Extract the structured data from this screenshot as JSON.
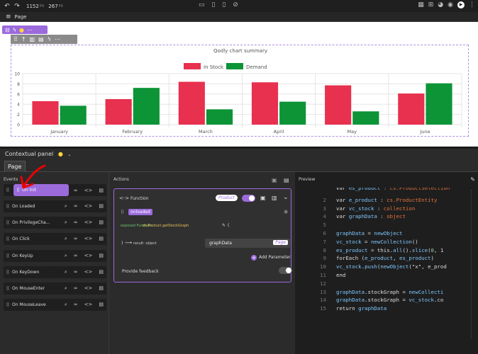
{
  "topbar": {
    "width_value": "1152",
    "width_unit": "PX",
    "height_value": "267",
    "height_unit": "PX"
  },
  "pagebar": {
    "label": "Page"
  },
  "chart_data": {
    "type": "bar",
    "title": "Qodly chart summary",
    "categories": [
      "January",
      "February",
      "March",
      "April",
      "May",
      "June"
    ],
    "series": [
      {
        "name": "In Stock",
        "color": "#e8304f",
        "values": [
          4.6,
          5.0,
          8.4,
          8.3,
          7.7,
          6.1
        ]
      },
      {
        "name": "Demand",
        "color": "#0c9436",
        "values": [
          3.7,
          7.2,
          3.0,
          4.5,
          2.6,
          8.1
        ]
      }
    ],
    "ylim": [
      0,
      10
    ],
    "yticks": [
      "0",
      "2",
      "4",
      "6",
      "8",
      "10"
    ],
    "grid": true,
    "legend": "top-center"
  },
  "contextual": {
    "title": "Contextual panel",
    "tab": "Page"
  },
  "events": {
    "title": "Events",
    "items": [
      {
        "label": "On Init"
      },
      {
        "label": "On Loaded"
      },
      {
        "label": "On PrivilegeCha..."
      },
      {
        "label": "On Click"
      },
      {
        "label": "On KeyUp"
      },
      {
        "label": "On KeyDown"
      },
      {
        "label": "On MouseEnter"
      },
      {
        "label": "On MouseLeave"
      }
    ]
  },
  "actions": {
    "title": "Actions",
    "function_label": "Function",
    "product_badge": "Product",
    "event_tag": "onloaded",
    "exposed_prefix": "exposed Function",
    "exposed_name": "ds.Product.getStockGraph",
    "exposed_suffix": "(",
    "result_prefix": ")",
    "result_label": "result: object",
    "result_value": "graphData",
    "page_badge": "Page",
    "add_parameter": "Add Parameter",
    "provide_feedback": "Provide feedback"
  },
  "preview": {
    "title": "Preview",
    "lines": [
      {
        "n": "",
        "t": "var es_product : cs.ProductSelection"
      },
      {
        "n": "2",
        "t": "var e_product : cs.ProductEntity"
      },
      {
        "n": "3",
        "t": "var vc_stock : collection"
      },
      {
        "n": "4",
        "t": "var graphData : object"
      },
      {
        "n": "5",
        "t": ""
      },
      {
        "n": "6",
        "t": "graphData = newObject"
      },
      {
        "n": "7",
        "t": "vc_stock = newCollection()"
      },
      {
        "n": "8",
        "t": "es_product = this.all().slice(0, 1"
      },
      {
        "n": "9",
        "t": "forEach (e_product, es_product)"
      },
      {
        "n": "10",
        "t": "vc_stock.push(newObject(\"x\", e_prod"
      },
      {
        "n": "11",
        "t": "end"
      },
      {
        "n": "12",
        "t": ""
      },
      {
        "n": "13",
        "t": "graphData.stockGraph = newCollecti"
      },
      {
        "n": "14",
        "t": "graphData.stockGraph = vc_stock.co"
      },
      {
        "n": "15",
        "t": "return graphData"
      }
    ]
  }
}
